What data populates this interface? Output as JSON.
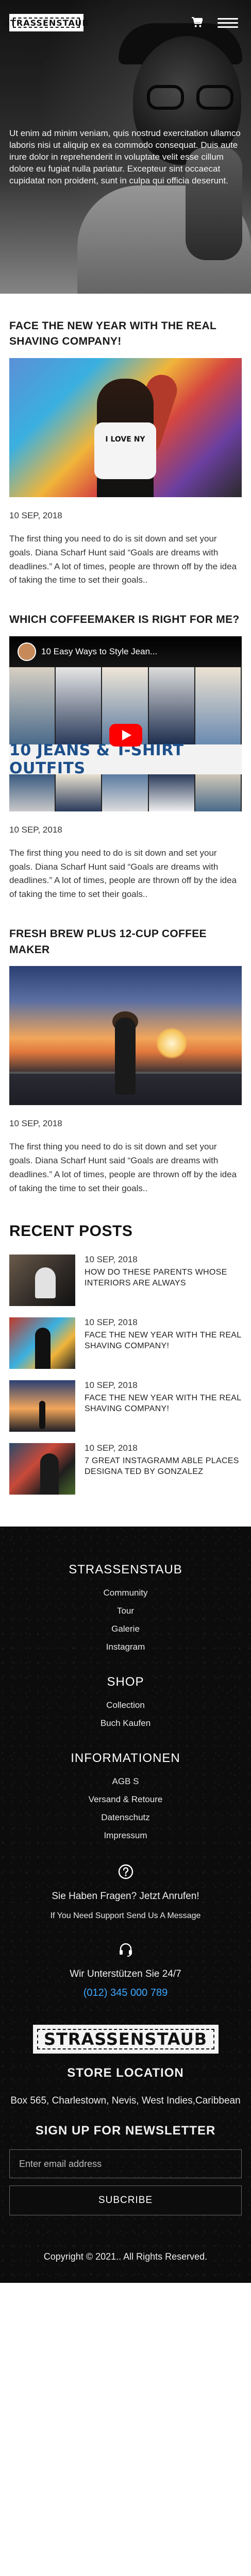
{
  "header": {
    "logo_text": "STRASSENSTAUB",
    "cart_icon": "cart-icon",
    "menu_icon": "hamburger-menu-icon",
    "colors": {
      "header_text": "#ffffff"
    }
  },
  "hero": {
    "text": "Ut enim ad minim veniam, quis nostrud exercitation ullamco laboris nisi ut aliquip ex ea commodo consequat. Duis aute irure dolor in reprehenderit in voluptate velit esse cillum dolore eu fugiat nulla pariatur. Excepteur sint occaecat cupidatat non proident, sunt in culpa qui officia deserunt."
  },
  "posts": [
    {
      "title": "FACE THE NEW YEAR WITH THE REAL SHAVING COMPANY!",
      "image_caption": "I LOVE NY",
      "date": "10 SEP, 2018",
      "excerpt": "The first thing you need to do is sit down and set your goals. Diana Scharf Hunt said “Goals are dreams with deadlines.” A lot of times, people are thrown off by the idea of taking the time to set their goals.."
    },
    {
      "title": "WHICH COFFEEMAKER IS RIGHT FOR ME?",
      "video_title": "10 Easy Ways to Style Jean...",
      "video_banner": "10 JEANS & T-SHIRT OUTFITS",
      "date": "10 SEP, 2018",
      "excerpt": "The first thing you need to do is sit down and set your goals. Diana Scharf Hunt said “Goals are dreams with deadlines.” A lot of times, people are thrown off by the idea of taking the time to set their goals.."
    },
    {
      "title": "FRESH BREW PLUS 12-CUP COFFEE MAKER",
      "date": "10 SEP, 2018",
      "excerpt": "The first thing you need to do is sit down and set your goals. Diana Scharf Hunt said “Goals are dreams with deadlines.” A lot of times, people are thrown off by the idea of taking the time to set their goals.."
    }
  ],
  "recent": {
    "heading": "RECENT POSTS",
    "items": [
      {
        "date": "10 SEP, 2018",
        "title": "HOW DO THESE PARENTS WHOSE INTERIORS ARE ALWAYS"
      },
      {
        "date": "10 SEP, 2018",
        "title": "FACE THE NEW YEAR WITH THE REAL SHAVING COMPANY!"
      },
      {
        "date": "10 SEP, 2018",
        "title": "FACE THE NEW YEAR WITH THE REAL SHAVING COMPANY!"
      },
      {
        "date": "10 SEP, 2018",
        "title": "7 GREAT INSTAGRAMM ABLE PLACES DESIGNA TED BY GONZALEZ"
      }
    ]
  },
  "footer": {
    "brand_heading": "STRASSENSTAUB",
    "brand_links": [
      "Community",
      "Tour",
      "Galerie",
      "Instagram"
    ],
    "shop_heading": "SHOP",
    "shop_links": [
      "Collection",
      "Buch Kaufen"
    ],
    "info_heading": "INFORMATIONEN",
    "info_links": [
      "AGB S",
      "Versand & Retoure",
      "Datenschutz",
      "Impressum"
    ],
    "question": "Sie Haben Fragen? Jetzt Anrufen!",
    "support_note": "If You Need Support Send Us A Message",
    "support_line": "Wir Unterstützen Sie 24/7",
    "phone": "(012) 345 000 789",
    "logo_text": "STRASSENSTAUB",
    "store_heading": "STORE LOCATION",
    "address": "Box 565, Charlestown, Nevis, West Indies,Caribbean",
    "newsletter_heading": "SIGN UP FOR NEWSLETTER",
    "email_placeholder": "Enter email address",
    "subscribe_label": "SUBCRIBE",
    "copyright": "Copyright © 2021.. All Rights Reserved.",
    "colors": {
      "background": "#0c0c0c",
      "phone": "#3fa9ff"
    }
  }
}
